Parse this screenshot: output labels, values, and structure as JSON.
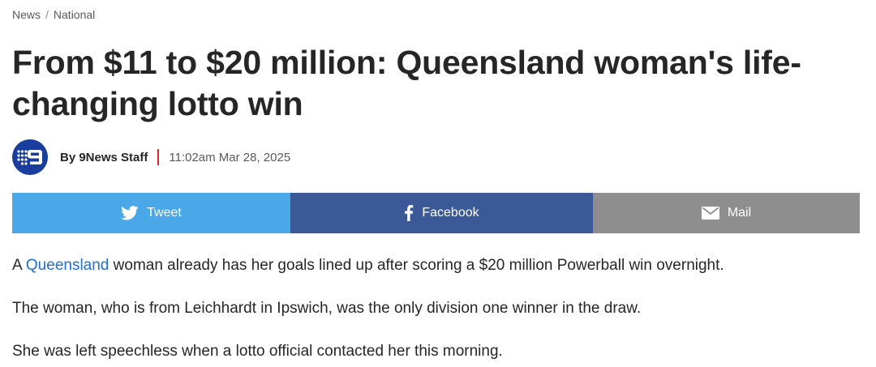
{
  "breadcrumb": {
    "items": [
      "News",
      "National"
    ],
    "separator": "/"
  },
  "article": {
    "headline": "From $11 to $20 million: Queensland woman's life-changing lotto win",
    "author": "By 9News Staff",
    "timestamp": "11:02am Mar 28, 2025",
    "logo_icon": "nine-network-logo"
  },
  "share": {
    "tweet_label": "Tweet",
    "facebook_label": "Facebook",
    "mail_label": "Mail"
  },
  "body": {
    "p1_prefix": "A ",
    "p1_link": "Queensland",
    "p1_suffix": " woman already has her goals lined up after scoring a $20 million Powerball win overnight.",
    "p2": "The woman, who is from Leichhardt in Ipswich, was the only division one winner in the draw.",
    "p3": "She was left speechless when a lotto official contacted her this morning."
  },
  "colors": {
    "tweet": "#4aa7e8",
    "facebook": "#3b5997",
    "mail": "#8e8e8e",
    "link": "#1f6fd6",
    "divider": "#d9262b",
    "logo": "#1a3e9e"
  }
}
